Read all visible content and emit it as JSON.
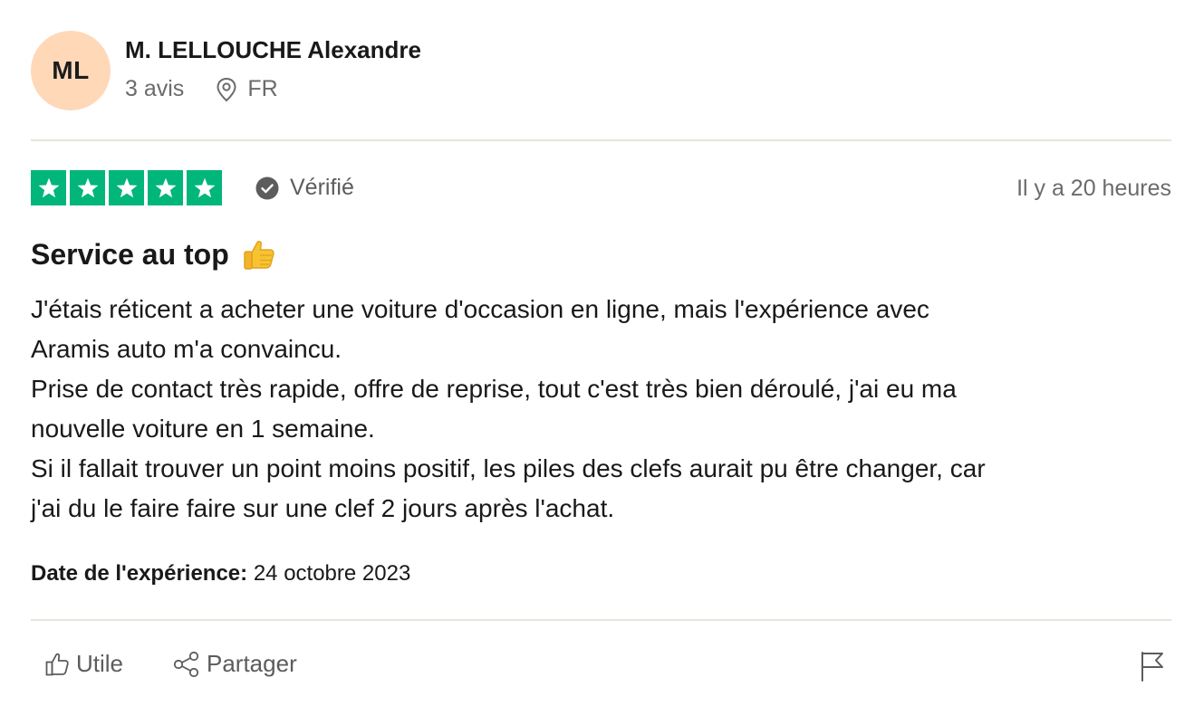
{
  "reviewer": {
    "initials": "ML",
    "name": "M. LELLOUCHE Alexandre",
    "reviews_count": "3 avis",
    "country": "FR"
  },
  "rating": {
    "stars": 5,
    "max_stars": 5,
    "star_color": "#00b67a",
    "verified_label": "Vérifié",
    "time_ago": "Il y a 20 heures"
  },
  "review": {
    "title": "Service au top",
    "title_emoji_icon": "thumbs-up-icon",
    "body_lines": [
      "J'étais réticent a acheter une voiture d'occasion en ligne, mais l'expérience avec",
      "Aramis auto m'a convaincu.",
      "Prise de contact très rapide, offre de reprise, tout c'est très bien déroulé, j'ai eu ma",
      "nouvelle voiture en 1 semaine.",
      "Si il fallait trouver un point moins positif, les piles des clefs aurait pu être changer, car",
      "j'ai du le faire faire sur une clef 2 jours après l'achat."
    ],
    "experience_date_label": "Date de l'expérience:",
    "experience_date_value": " 24 octobre 2023"
  },
  "actions": {
    "useful_label": "Utile",
    "share_label": "Partager",
    "flag_icon": "flag-icon"
  },
  "colors": {
    "avatar_bg": "#ffd8b8",
    "star_green": "#00b67a",
    "divider": "#e5e5dd",
    "muted_text": "#6b6b6b"
  }
}
